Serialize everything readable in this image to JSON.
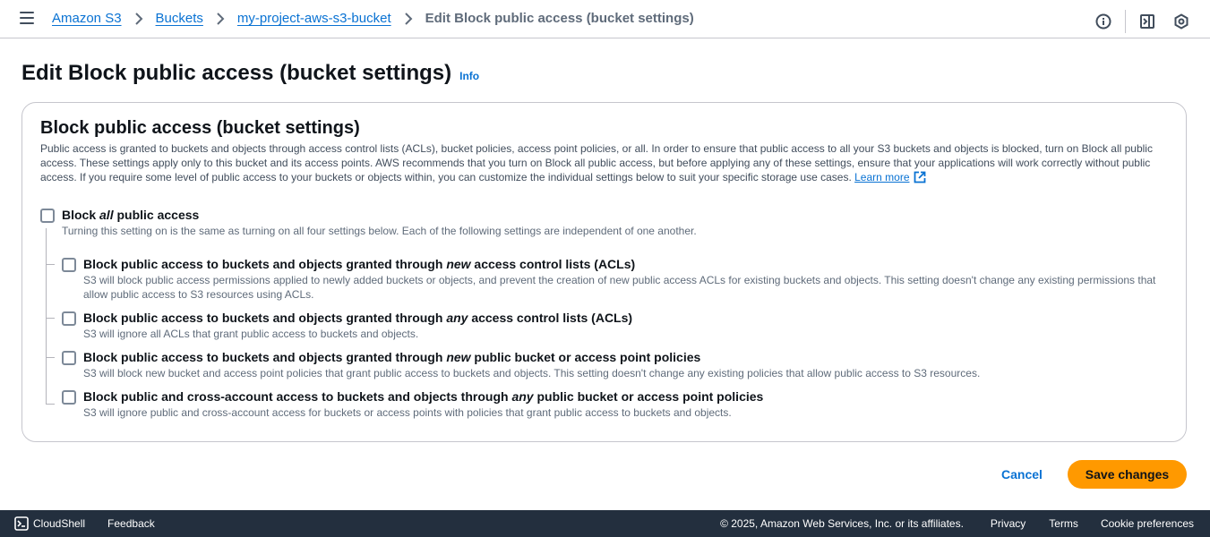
{
  "breadcrumb": {
    "items": [
      "Amazon S3",
      "Buckets",
      "my-project-aws-s3-bucket"
    ],
    "current": "Edit Block public access (bucket settings)"
  },
  "top_icons": [
    "info-circle-icon",
    "exit-panel-icon",
    "settings-hex-icon"
  ],
  "page": {
    "title": "Edit Block public access (bucket settings)",
    "info": "Info"
  },
  "section": {
    "title": "Block public access (bucket settings)",
    "description": "Public access is granted to buckets and objects through access control lists (ACLs), bucket policies, access point policies, or all. In order to ensure that public access to all your S3 buckets and objects is blocked, turn on Block all public access. These settings apply only to this bucket and its access points. AWS recommends that you turn on Block all public access, but before applying any of these settings, ensure that your applications will work correctly without public access. If you require some level of public access to your buckets or objects within, you can customize the individual settings below to suit your specific storage use cases.",
    "learn_more": "Learn more"
  },
  "block_all": {
    "label_pre": "Block ",
    "label_em": "all",
    "label_post": " public access",
    "description": "Turning this setting on is the same as turning on all four settings below. Each of the following settings are independent of one another.",
    "checked": false
  },
  "options": [
    {
      "label_pre": "Block public access to buckets and objects granted through ",
      "label_em": "new",
      "label_post": " access control lists (ACLs)",
      "description": "S3 will block public access permissions applied to newly added buckets or objects, and prevent the creation of new public access ACLs for existing buckets and objects. This setting doesn't change any existing permissions that allow public access to S3 resources using ACLs.",
      "checked": false
    },
    {
      "label_pre": "Block public access to buckets and objects granted through ",
      "label_em": "any",
      "label_post": " access control lists (ACLs)",
      "description": "S3 will ignore all ACLs that grant public access to buckets and objects.",
      "checked": false
    },
    {
      "label_pre": "Block public access to buckets and objects granted through ",
      "label_em": "new",
      "label_post": " public bucket or access point policies",
      "description": "S3 will block new bucket and access point policies that grant public access to buckets and objects. This setting doesn't change any existing policies that allow public access to S3 resources.",
      "checked": false
    },
    {
      "label_pre": "Block public and cross-account access to buckets and objects through ",
      "label_em": "any",
      "label_post": " public bucket or access point policies",
      "description": "S3 will ignore public and cross-account access for buckets or access points with policies that grant public access to buckets and objects.",
      "checked": false
    }
  ],
  "actions": {
    "cancel": "Cancel",
    "save": "Save changes"
  },
  "footer": {
    "cloudshell": "CloudShell",
    "feedback": "Feedback",
    "copyright": "© 2025, Amazon Web Services, Inc. or its affiliates.",
    "privacy": "Privacy",
    "terms": "Terms",
    "cookies": "Cookie preferences"
  },
  "colors": {
    "link": "#0972d3",
    "primary_button": "#ff9900",
    "footer_bg": "#232f3e"
  }
}
